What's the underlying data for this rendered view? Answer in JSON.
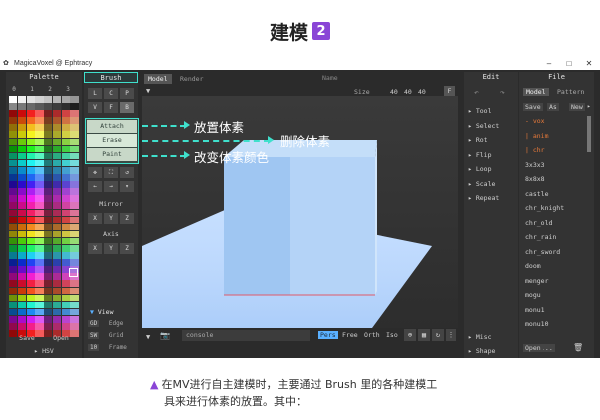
{
  "heading": {
    "text": "建模",
    "badge": "2"
  },
  "app": {
    "title": "MagicaVoxel @ Ephtracy",
    "window_name": "Name"
  },
  "palette": {
    "title": "Palette",
    "page_numbers": [
      "0",
      "1",
      "2",
      "3"
    ],
    "buttons": {
      "save": "Save",
      "open": "Open"
    },
    "hsv": "HSV"
  },
  "brush": {
    "title": "Brush",
    "types": [
      "L",
      "C",
      "P",
      "V",
      "F",
      "B"
    ],
    "modes": {
      "attach": "Attach",
      "erase": "Erase",
      "paint": "Paint"
    },
    "mirror": "Mirror",
    "axis": "Axis",
    "mirror_axes": [
      "X",
      "Y",
      "Z"
    ],
    "axes": [
      "X",
      "Y",
      "Z"
    ],
    "view_title": "View",
    "view_rows": [
      {
        "key": "GD",
        "label": "Edge"
      },
      {
        "key": "SW",
        "label": "Grid"
      },
      {
        "key": "10",
        "label": "Frame"
      }
    ]
  },
  "viewport": {
    "tabs": [
      "Model",
      "Render"
    ],
    "size_label": "Size",
    "size": [
      "40",
      "40",
      "40"
    ],
    "fit_btn": "F",
    "console": "console",
    "camera_modes": [
      "Pers",
      "Free",
      "Orth",
      "Iso"
    ]
  },
  "edit": {
    "title": "Edit",
    "items": [
      "Tool",
      "Select",
      "Rot",
      "Flip",
      "Loop",
      "Scale",
      "Repeat"
    ],
    "bottom": [
      "Misc",
      "Shape"
    ]
  },
  "file": {
    "title": "File",
    "tabs": [
      "Model",
      "Pattern"
    ],
    "buttons": [
      "Save",
      "As",
      "New"
    ],
    "items": [
      "- vox",
      "| anim",
      "| chr",
      "3x3x3",
      "8x8x8",
      "castle",
      "chr_knight",
      "chr_old",
      "chr_rain",
      "chr_sword",
      "doom",
      "menger",
      "mogu",
      "monu1",
      "monu10"
    ],
    "bottom_buttons": [
      "Open",
      "..."
    ],
    "export": "Export"
  },
  "callouts": {
    "attach": "放置体素",
    "erase": "删除体素",
    "paint": "改变体素颜色"
  },
  "caption": {
    "line1": "在MV进行自主建模时，主要通过 Brush 里的各种建模工",
    "line2": "具来进行体素的放置。其中："
  },
  "colors": {
    "accent_teal": "#3fe0cc",
    "badge_purple": "#8a45d6",
    "cube": "#a9cdf5",
    "ground": "#bcd9ff",
    "file_highlight": "#e87a3a"
  }
}
